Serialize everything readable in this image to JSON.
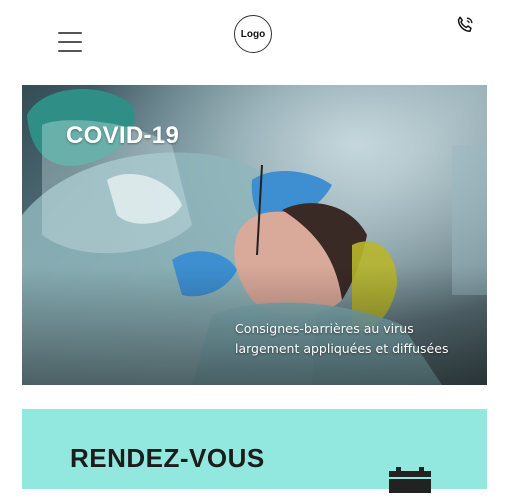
{
  "header": {
    "logo_text": "Logo",
    "menu_icon": "hamburger-menu-icon",
    "phone_icon": "phone-icon"
  },
  "hero": {
    "title": "COVID-19",
    "caption": "Consignes-barrières au virus largement appliquées et diffusées",
    "image": "dentist-with-face-shield-treating-patient"
  },
  "rdv": {
    "title": "RENDEZ-VOUS",
    "icon": "calendar-icon",
    "background": "#92e8df"
  }
}
